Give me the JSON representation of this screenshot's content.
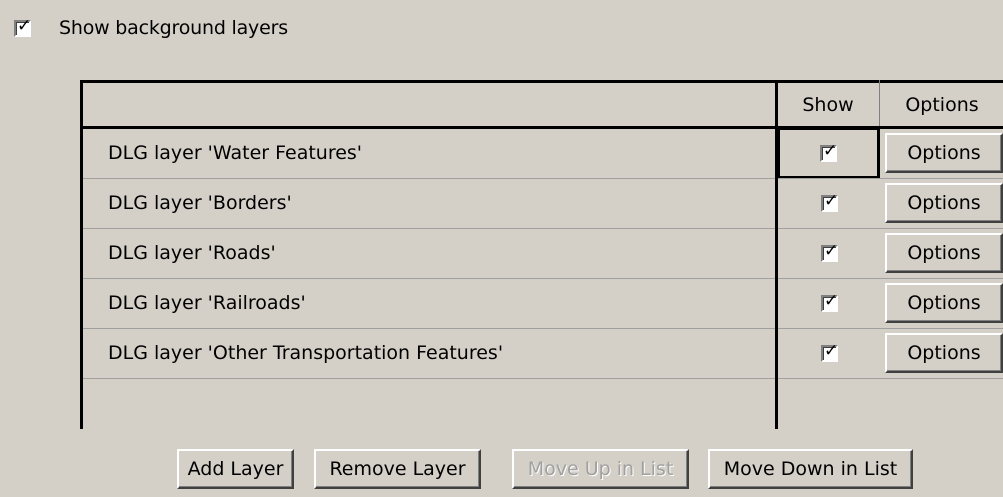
{
  "show_background_layers": {
    "label": "Show background layers",
    "checked": true,
    "check_glyph": "✓"
  },
  "grid": {
    "columns": {
      "name": "",
      "show": "Show",
      "options": "Options"
    },
    "rows": [
      {
        "name": "DLG layer 'Water Features'",
        "show": true,
        "options_label": "Options",
        "focused": true
      },
      {
        "name": "DLG layer 'Borders'",
        "show": true,
        "options_label": "Options",
        "focused": false
      },
      {
        "name": "DLG layer 'Roads'",
        "show": true,
        "options_label": "Options",
        "focused": false
      },
      {
        "name": "DLG layer 'Railroads'",
        "show": true,
        "options_label": "Options",
        "focused": false
      },
      {
        "name": "DLG layer 'Other Transportation Features'",
        "show": true,
        "options_label": "Options",
        "focused": false
      }
    ]
  },
  "buttons": {
    "add_layer": "Add Layer",
    "remove_layer": "Remove Layer",
    "move_up": "Move Up in List",
    "move_down": "Move Down in List"
  },
  "colors": {
    "face": "#d4d0c8",
    "disabled_text": "#a0a0a0"
  }
}
